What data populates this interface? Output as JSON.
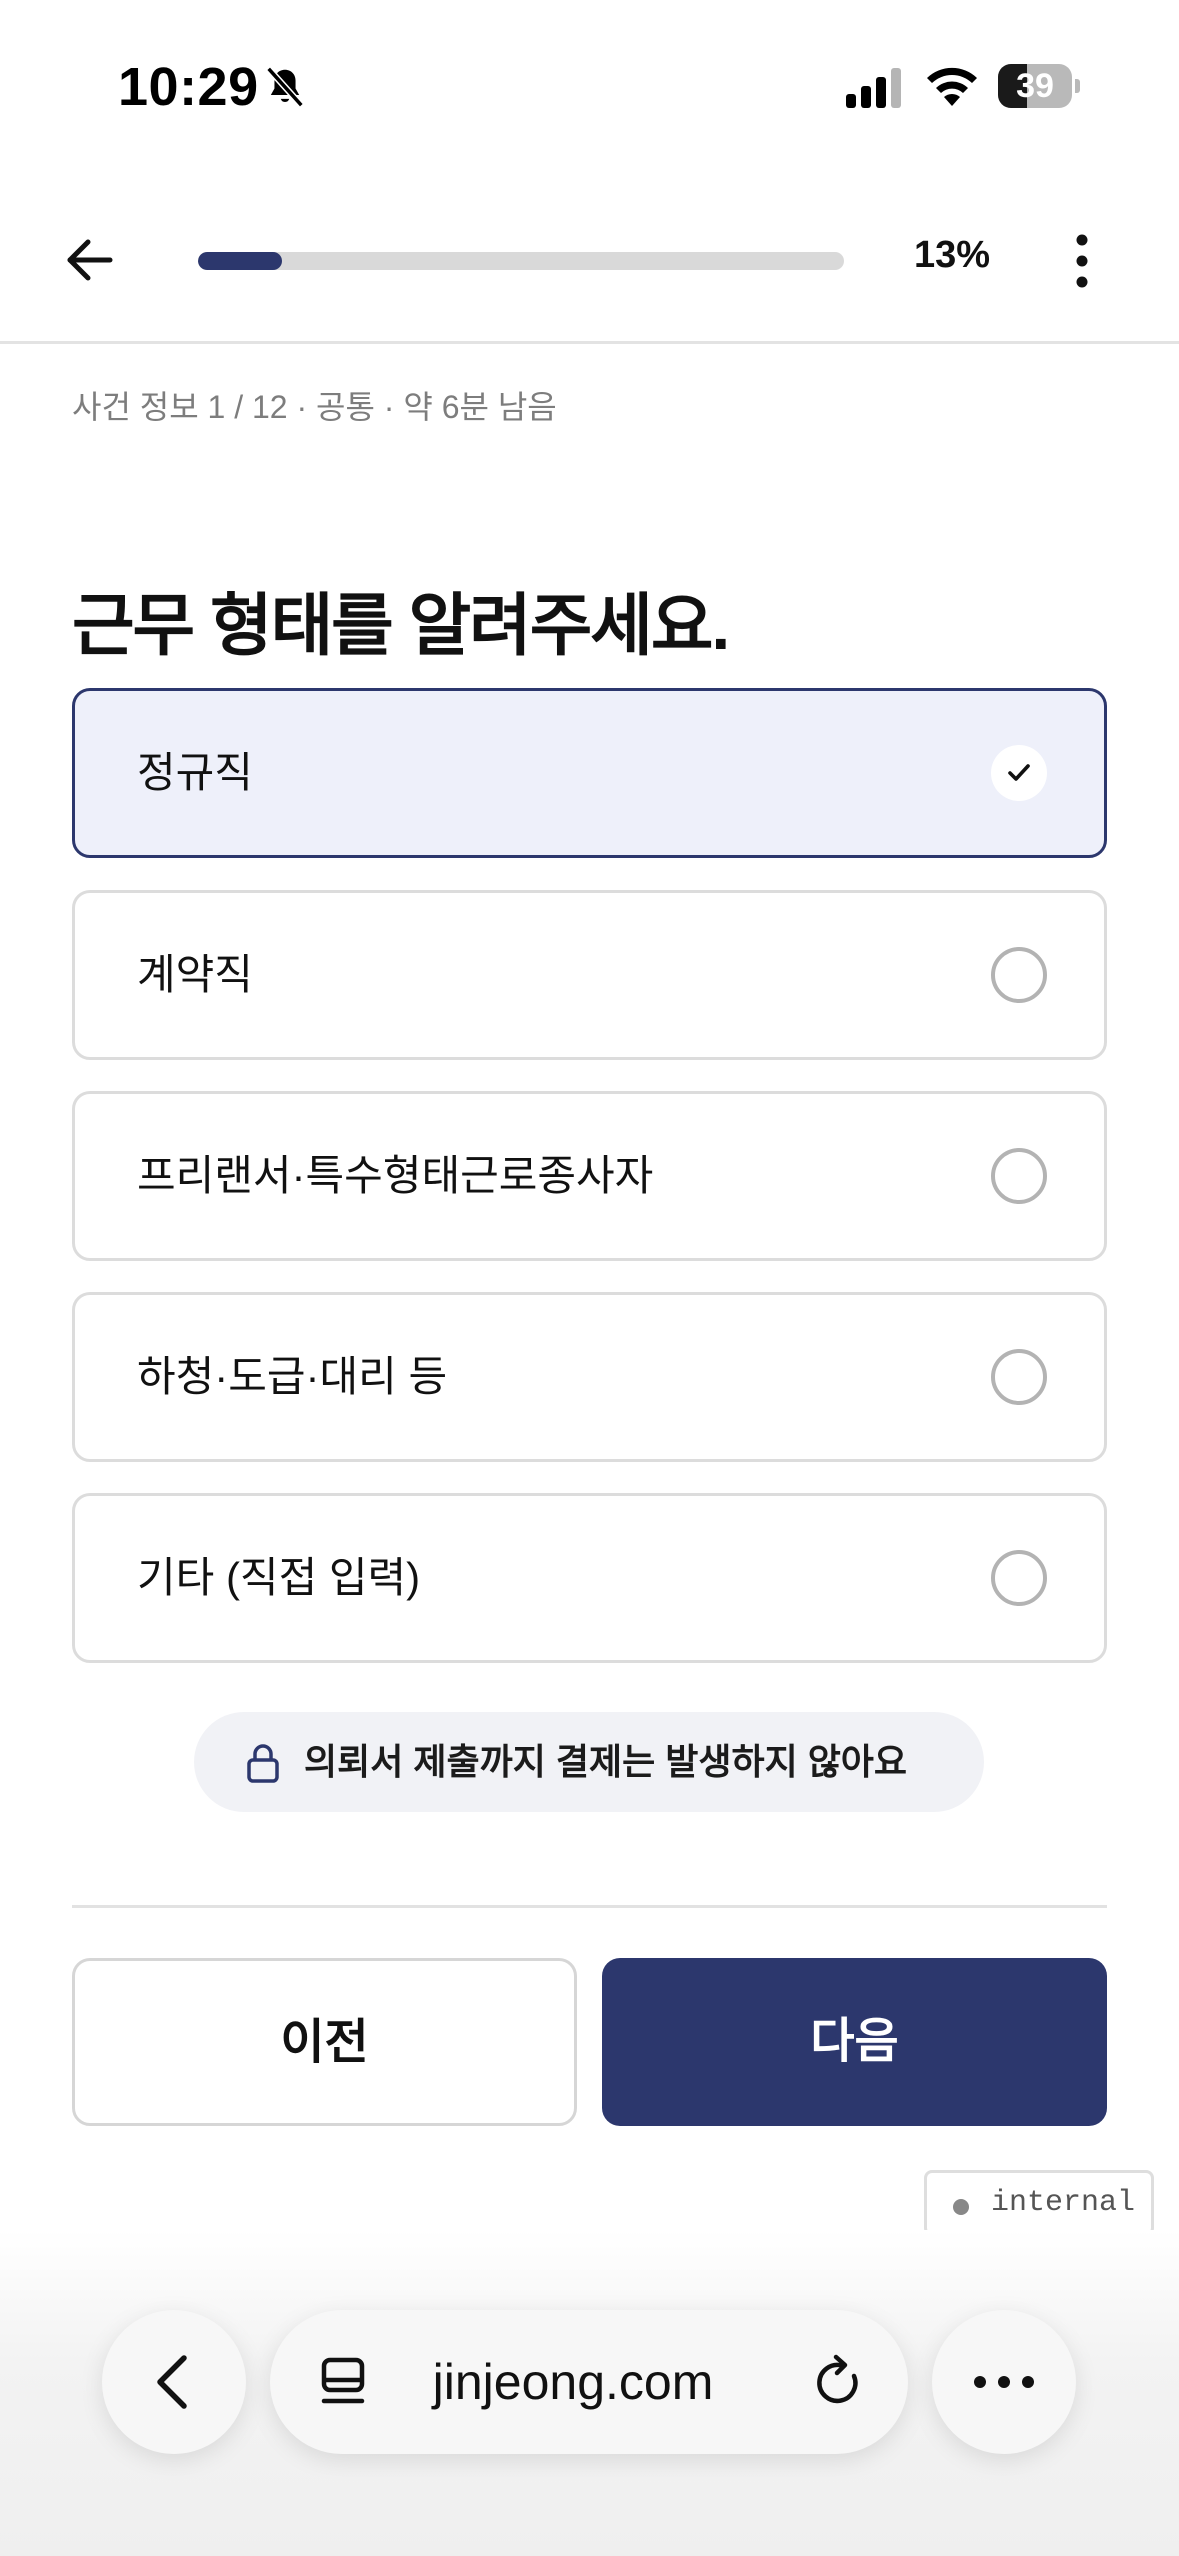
{
  "status_bar": {
    "time": "10:29",
    "battery": "39",
    "battery_level": 0.39
  },
  "progress": {
    "percent_label": "13%",
    "value": 0.13
  },
  "step_info": "사건 정보 1 / 12 · 공통 · 약 6분 남음",
  "question": "근무 형태를 알려주세요.",
  "options": [
    {
      "label": "정규직",
      "selected": true
    },
    {
      "label": "계약직",
      "selected": false
    },
    {
      "label": "프리랜서·특수형태근로종사자",
      "selected": false
    },
    {
      "label": "하청·도급·대리 등",
      "selected": false
    },
    {
      "label": "기타 (직접 입력)",
      "selected": false
    }
  ],
  "notice": "의뢰서 제출까지 결제는 발생하지 않아요",
  "buttons": {
    "prev": "이전",
    "next": "다음"
  },
  "badge": "internal",
  "browser": {
    "url": "jinjeong.com"
  },
  "colors": {
    "accent": "#2c376d",
    "selected_bg": "#eef0fa"
  }
}
